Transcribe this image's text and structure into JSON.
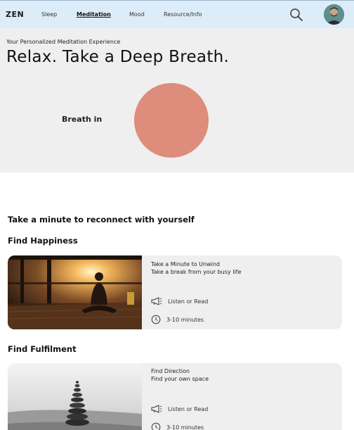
{
  "nav": {
    "brand": "ZEN",
    "links": [
      {
        "label": "Sleep",
        "active": false
      },
      {
        "label": "Meditation",
        "active": true
      },
      {
        "label": "Mood",
        "active": false
      },
      {
        "label": "Resource/Info",
        "active": false
      }
    ],
    "icons": [
      "search-icon",
      "avatar"
    ]
  },
  "hero": {
    "subtitle": "Your Personalized Meditation Experience",
    "title": "Relax. Take a Deep Breath.",
    "breath_label": "Breath in",
    "circle_color": "#de8c7c"
  },
  "intro": "Take a minute to reconnect with yourself",
  "sections": [
    {
      "heading": "Find Happiness",
      "card": {
        "title": "Take a Minute to Unwind",
        "description": "Take a break from your busy life",
        "format": "Listen or Read",
        "duration": "3-10 minutes",
        "image": "meditation-sunset-photo"
      }
    },
    {
      "heading": "Find Fulfilment",
      "card": {
        "title": "Find Direction",
        "description": "Find your own space",
        "format": "Listen or Read",
        "duration": "3-10 minutes",
        "image": "stacked-stones-photo"
      }
    }
  ]
}
